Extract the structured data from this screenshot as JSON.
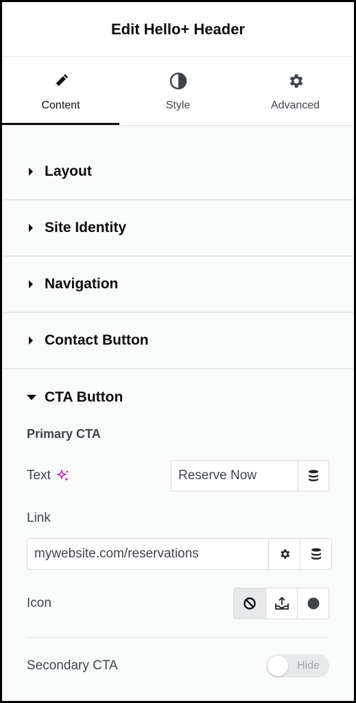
{
  "header": {
    "title": "Edit Hello+ Header"
  },
  "tabs": [
    {
      "label": "Content",
      "icon": "pencil-icon",
      "active": true
    },
    {
      "label": "Style",
      "icon": "half-circle-icon",
      "active": false
    },
    {
      "label": "Advanced",
      "icon": "gear-icon",
      "active": false
    }
  ],
  "sections": [
    {
      "title": "Layout"
    },
    {
      "title": "Site Identity"
    },
    {
      "title": "Navigation"
    },
    {
      "title": "Contact Button"
    }
  ],
  "cta": {
    "title": "CTA Button",
    "primary_heading": "Primary CTA",
    "text_label": "Text",
    "text_value": "Reserve Now",
    "link_label": "Link",
    "link_value": "mywebsite.com/reservations",
    "icon_label": "Icon",
    "icon_options": [
      "none-icon",
      "upload-icon",
      "circle-icon"
    ],
    "secondary_label": "Secondary CTA",
    "secondary_toggle": "Hide"
  },
  "colors": {
    "ai_accent": "#c21fb1",
    "text": "#3f444b"
  }
}
